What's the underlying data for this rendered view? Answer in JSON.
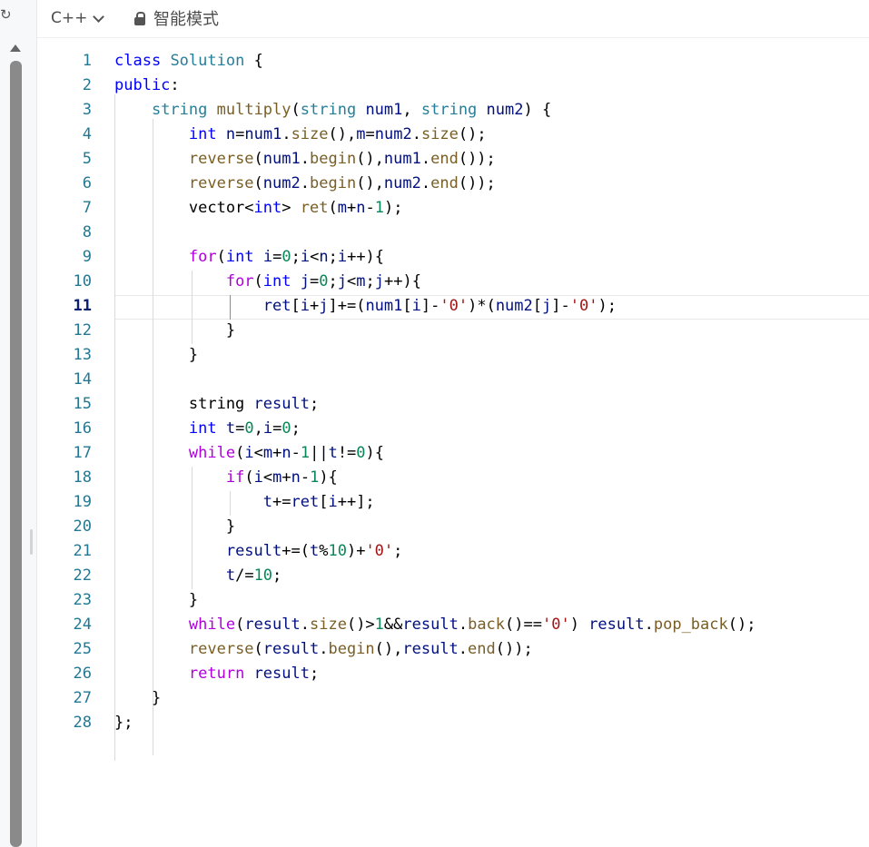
{
  "toolbar": {
    "language": "C++",
    "mode": "智能模式"
  },
  "editor": {
    "active_line": 11,
    "lines": [
      {
        "n": "1",
        "tokens": [
          [
            "kw",
            "class"
          ],
          [
            "p",
            " "
          ],
          [
            "ty",
            "Solution"
          ],
          [
            "p",
            " {"
          ]
        ]
      },
      {
        "n": "2",
        "tokens": [
          [
            "kw",
            "public"
          ],
          [
            "p",
            ":"
          ]
        ]
      },
      {
        "n": "3",
        "tokens": [
          [
            "p",
            "    "
          ],
          [
            "ty",
            "string"
          ],
          [
            "p",
            " "
          ],
          [
            "fn",
            "multiply"
          ],
          [
            "p",
            "("
          ],
          [
            "ty",
            "string"
          ],
          [
            "p",
            " "
          ],
          [
            "vr",
            "num1"
          ],
          [
            "p",
            ", "
          ],
          [
            "ty",
            "string"
          ],
          [
            "p",
            " "
          ],
          [
            "vr",
            "num2"
          ],
          [
            "p",
            ") {"
          ]
        ]
      },
      {
        "n": "4",
        "tokens": [
          [
            "p",
            "        "
          ],
          [
            "kw",
            "int"
          ],
          [
            "p",
            " "
          ],
          [
            "vr",
            "n"
          ],
          [
            "p",
            "="
          ],
          [
            "vr",
            "num1"
          ],
          [
            "p",
            "."
          ],
          [
            "fn",
            "size"
          ],
          [
            "p",
            "(),"
          ],
          [
            "vr",
            "m"
          ],
          [
            "p",
            "="
          ],
          [
            "vr",
            "num2"
          ],
          [
            "p",
            "."
          ],
          [
            "fn",
            "size"
          ],
          [
            "p",
            "();"
          ]
        ]
      },
      {
        "n": "5",
        "tokens": [
          [
            "p",
            "        "
          ],
          [
            "fn",
            "reverse"
          ],
          [
            "p",
            "("
          ],
          [
            "vr",
            "num1"
          ],
          [
            "p",
            "."
          ],
          [
            "fn",
            "begin"
          ],
          [
            "p",
            "(),"
          ],
          [
            "vr",
            "num1"
          ],
          [
            "p",
            "."
          ],
          [
            "fn",
            "end"
          ],
          [
            "p",
            "());"
          ]
        ]
      },
      {
        "n": "6",
        "tokens": [
          [
            "p",
            "        "
          ],
          [
            "fn",
            "reverse"
          ],
          [
            "p",
            "("
          ],
          [
            "vr",
            "num2"
          ],
          [
            "p",
            "."
          ],
          [
            "fn",
            "begin"
          ],
          [
            "p",
            "(),"
          ],
          [
            "vr",
            "num2"
          ],
          [
            "p",
            "."
          ],
          [
            "fn",
            "end"
          ],
          [
            "p",
            "());"
          ]
        ]
      },
      {
        "n": "7",
        "tokens": [
          [
            "p",
            "        vector<"
          ],
          [
            "kw",
            "int"
          ],
          [
            "p",
            "> "
          ],
          [
            "fn",
            "ret"
          ],
          [
            "p",
            "("
          ],
          [
            "vr",
            "m"
          ],
          [
            "p",
            "+"
          ],
          [
            "vr",
            "n"
          ],
          [
            "p",
            "-"
          ],
          [
            "nm",
            "1"
          ],
          [
            "p",
            ");"
          ]
        ]
      },
      {
        "n": "8",
        "tokens": []
      },
      {
        "n": "9",
        "tokens": [
          [
            "p",
            "        "
          ],
          [
            "ct",
            "for"
          ],
          [
            "p",
            "("
          ],
          [
            "kw",
            "int"
          ],
          [
            "p",
            " "
          ],
          [
            "vr",
            "i"
          ],
          [
            "p",
            "="
          ],
          [
            "nm",
            "0"
          ],
          [
            "p",
            ";"
          ],
          [
            "vr",
            "i"
          ],
          [
            "p",
            "<"
          ],
          [
            "vr",
            "n"
          ],
          [
            "p",
            ";"
          ],
          [
            "vr",
            "i"
          ],
          [
            "p",
            "++){"
          ]
        ]
      },
      {
        "n": "10",
        "tokens": [
          [
            "p",
            "            "
          ],
          [
            "ct",
            "for"
          ],
          [
            "p",
            "("
          ],
          [
            "kw",
            "int"
          ],
          [
            "p",
            " "
          ],
          [
            "vr",
            "j"
          ],
          [
            "p",
            "="
          ],
          [
            "nm",
            "0"
          ],
          [
            "p",
            ";"
          ],
          [
            "vr",
            "j"
          ],
          [
            "p",
            "<"
          ],
          [
            "vr",
            "m"
          ],
          [
            "p",
            ";"
          ],
          [
            "vr",
            "j"
          ],
          [
            "p",
            "++){"
          ]
        ]
      },
      {
        "n": "11",
        "tokens": [
          [
            "p",
            "                "
          ],
          [
            "vr",
            "ret"
          ],
          [
            "p",
            "["
          ],
          [
            "vr",
            "i"
          ],
          [
            "p",
            "+"
          ],
          [
            "vr",
            "j"
          ],
          [
            "p",
            "]+=("
          ],
          [
            "vr",
            "num1"
          ],
          [
            "p",
            "["
          ],
          [
            "vr",
            "i"
          ],
          [
            "p",
            "]-"
          ],
          [
            "st",
            "'0'"
          ],
          [
            "p",
            ")*("
          ],
          [
            "vr",
            "num2"
          ],
          [
            "p",
            "["
          ],
          [
            "vr",
            "j"
          ],
          [
            "p",
            "]-"
          ],
          [
            "st",
            "'0'"
          ],
          [
            "p",
            ");"
          ]
        ]
      },
      {
        "n": "12",
        "tokens": [
          [
            "p",
            "            }"
          ]
        ]
      },
      {
        "n": "13",
        "tokens": [
          [
            "p",
            "        }"
          ]
        ]
      },
      {
        "n": "14",
        "tokens": []
      },
      {
        "n": "15",
        "tokens": [
          [
            "p",
            "        string "
          ],
          [
            "vr",
            "result"
          ],
          [
            "p",
            ";"
          ]
        ]
      },
      {
        "n": "16",
        "tokens": [
          [
            "p",
            "        "
          ],
          [
            "kw",
            "int"
          ],
          [
            "p",
            " "
          ],
          [
            "vr",
            "t"
          ],
          [
            "p",
            "="
          ],
          [
            "nm",
            "0"
          ],
          [
            "p",
            ","
          ],
          [
            "vr",
            "i"
          ],
          [
            "p",
            "="
          ],
          [
            "nm",
            "0"
          ],
          [
            "p",
            ";"
          ]
        ]
      },
      {
        "n": "17",
        "tokens": [
          [
            "p",
            "        "
          ],
          [
            "ct",
            "while"
          ],
          [
            "p",
            "("
          ],
          [
            "vr",
            "i"
          ],
          [
            "p",
            "<"
          ],
          [
            "vr",
            "m"
          ],
          [
            "p",
            "+"
          ],
          [
            "vr",
            "n"
          ],
          [
            "p",
            "-"
          ],
          [
            "nm",
            "1"
          ],
          [
            "p",
            "||"
          ],
          [
            "vr",
            "t"
          ],
          [
            "p",
            "!="
          ],
          [
            "nm",
            "0"
          ],
          [
            "p",
            "){"
          ]
        ]
      },
      {
        "n": "18",
        "tokens": [
          [
            "p",
            "            "
          ],
          [
            "ct",
            "if"
          ],
          [
            "p",
            "("
          ],
          [
            "vr",
            "i"
          ],
          [
            "p",
            "<"
          ],
          [
            "vr",
            "m"
          ],
          [
            "p",
            "+"
          ],
          [
            "vr",
            "n"
          ],
          [
            "p",
            "-"
          ],
          [
            "nm",
            "1"
          ],
          [
            "p",
            "){"
          ]
        ]
      },
      {
        "n": "19",
        "tokens": [
          [
            "p",
            "                "
          ],
          [
            "vr",
            "t"
          ],
          [
            "p",
            "+="
          ],
          [
            "vr",
            "ret"
          ],
          [
            "p",
            "["
          ],
          [
            "vr",
            "i"
          ],
          [
            "p",
            "++];"
          ]
        ]
      },
      {
        "n": "20",
        "tokens": [
          [
            "p",
            "            }"
          ]
        ]
      },
      {
        "n": "21",
        "tokens": [
          [
            "p",
            "            "
          ],
          [
            "vr",
            "result"
          ],
          [
            "p",
            "+=("
          ],
          [
            "vr",
            "t"
          ],
          [
            "p",
            "%"
          ],
          [
            "nm",
            "10"
          ],
          [
            "p",
            ")+"
          ],
          [
            "st",
            "'0'"
          ],
          [
            "p",
            ";"
          ]
        ]
      },
      {
        "n": "22",
        "tokens": [
          [
            "p",
            "            "
          ],
          [
            "vr",
            "t"
          ],
          [
            "p",
            "/="
          ],
          [
            "nm",
            "10"
          ],
          [
            "p",
            ";"
          ]
        ]
      },
      {
        "n": "23",
        "tokens": [
          [
            "p",
            "        }"
          ]
        ]
      },
      {
        "n": "24",
        "tokens": [
          [
            "p",
            "        "
          ],
          [
            "ct",
            "while"
          ],
          [
            "p",
            "("
          ],
          [
            "vr",
            "result"
          ],
          [
            "p",
            "."
          ],
          [
            "fn",
            "size"
          ],
          [
            "p",
            "()>"
          ],
          [
            "nm",
            "1"
          ],
          [
            "p",
            "&&"
          ],
          [
            "vr",
            "result"
          ],
          [
            "p",
            "."
          ],
          [
            "fn",
            "back"
          ],
          [
            "p",
            "()=="
          ],
          [
            "st",
            "'0'"
          ],
          [
            "p",
            ") "
          ],
          [
            "vr",
            "result"
          ],
          [
            "p",
            "."
          ],
          [
            "fn",
            "pop_back"
          ],
          [
            "p",
            "();"
          ]
        ]
      },
      {
        "n": "25",
        "tokens": [
          [
            "p",
            "        "
          ],
          [
            "fn",
            "reverse"
          ],
          [
            "p",
            "("
          ],
          [
            "vr",
            "result"
          ],
          [
            "p",
            "."
          ],
          [
            "fn",
            "begin"
          ],
          [
            "p",
            "(),"
          ],
          [
            "vr",
            "result"
          ],
          [
            "p",
            "."
          ],
          [
            "fn",
            "end"
          ],
          [
            "p",
            "());"
          ]
        ]
      },
      {
        "n": "26",
        "tokens": [
          [
            "p",
            "        "
          ],
          [
            "ct",
            "return"
          ],
          [
            "p",
            " "
          ],
          [
            "vr",
            "result"
          ],
          [
            "p",
            ";"
          ]
        ]
      },
      {
        "n": "27",
        "tokens": [
          [
            "p",
            "    }"
          ]
        ]
      },
      {
        "n": "28",
        "tokens": [
          [
            "p",
            "};"
          ]
        ]
      }
    ]
  }
}
